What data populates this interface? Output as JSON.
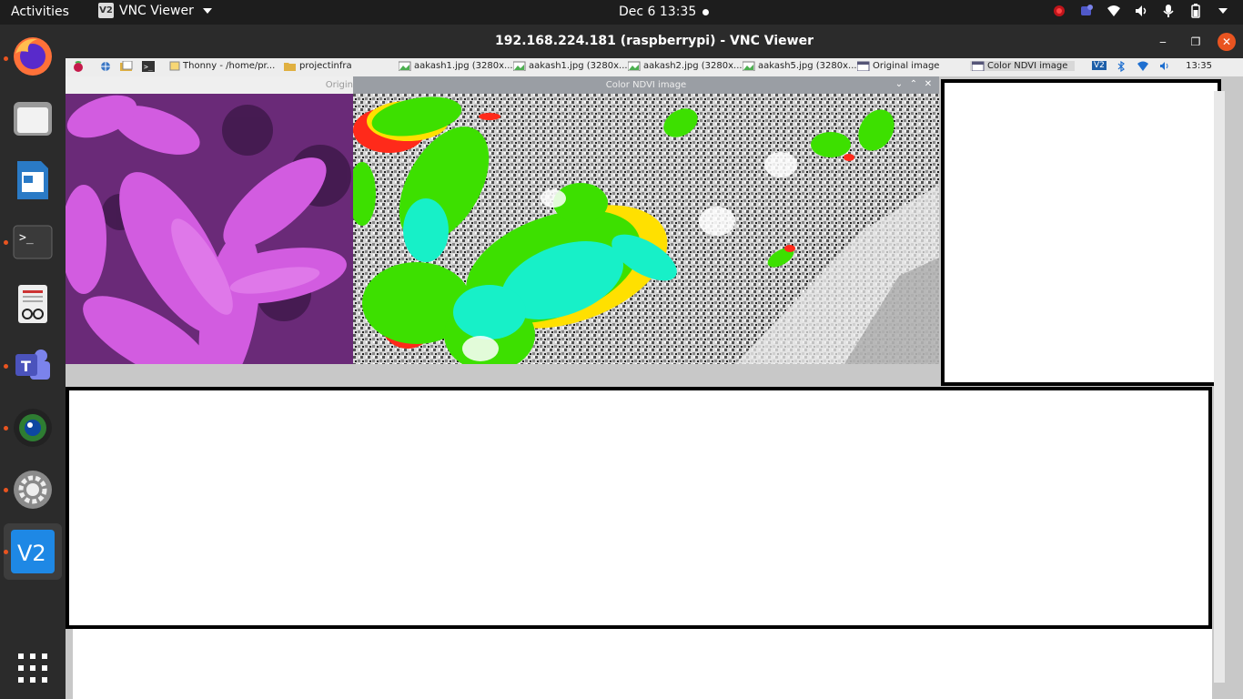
{
  "topbar": {
    "activities": "Activities",
    "app_name": "VNC Viewer",
    "app_icon_text": "V2",
    "clock": "Dec 6  13:35"
  },
  "dock": {
    "items": [
      "firefox-icon",
      "files-icon",
      "writer-icon",
      "terminal-icon",
      "document-viewer-icon",
      "teams-icon",
      "camera-icon",
      "settings-icon",
      "vnc-viewer-icon",
      "show-apps-icon"
    ]
  },
  "vnc": {
    "title": "192.168.224.181 (raspberrypi) - VNC Viewer",
    "minimize": "‒",
    "maximize": "❐",
    "close": "✕"
  },
  "rpi_taskbar": {
    "items": [
      {
        "label": "Thonny  -  /home/pr..."
      },
      {
        "label": "projectinfra"
      },
      {
        "label": "aakash1.jpg (3280x..."
      },
      {
        "label": "aakash1.jpg (3280x..."
      },
      {
        "label": "aakash2.jpg (3280x..."
      },
      {
        "label": "aakash5.jpg (3280x..."
      },
      {
        "label": "Original image"
      },
      {
        "label": "Color NDVI image"
      }
    ],
    "vnc_badge": "V2",
    "time": "13:35"
  },
  "windows": {
    "original_title": "Origin",
    "ndvi_title": "Color NDVI image",
    "ndvi_buttons": {
      "minimize": "⌄",
      "maximize": "⌃",
      "close": "✕"
    }
  },
  "colors": {
    "ubuntu_orange": "#e95420",
    "vnc_blue": "#1e88e5",
    "magenta_image": "#c040d0"
  }
}
